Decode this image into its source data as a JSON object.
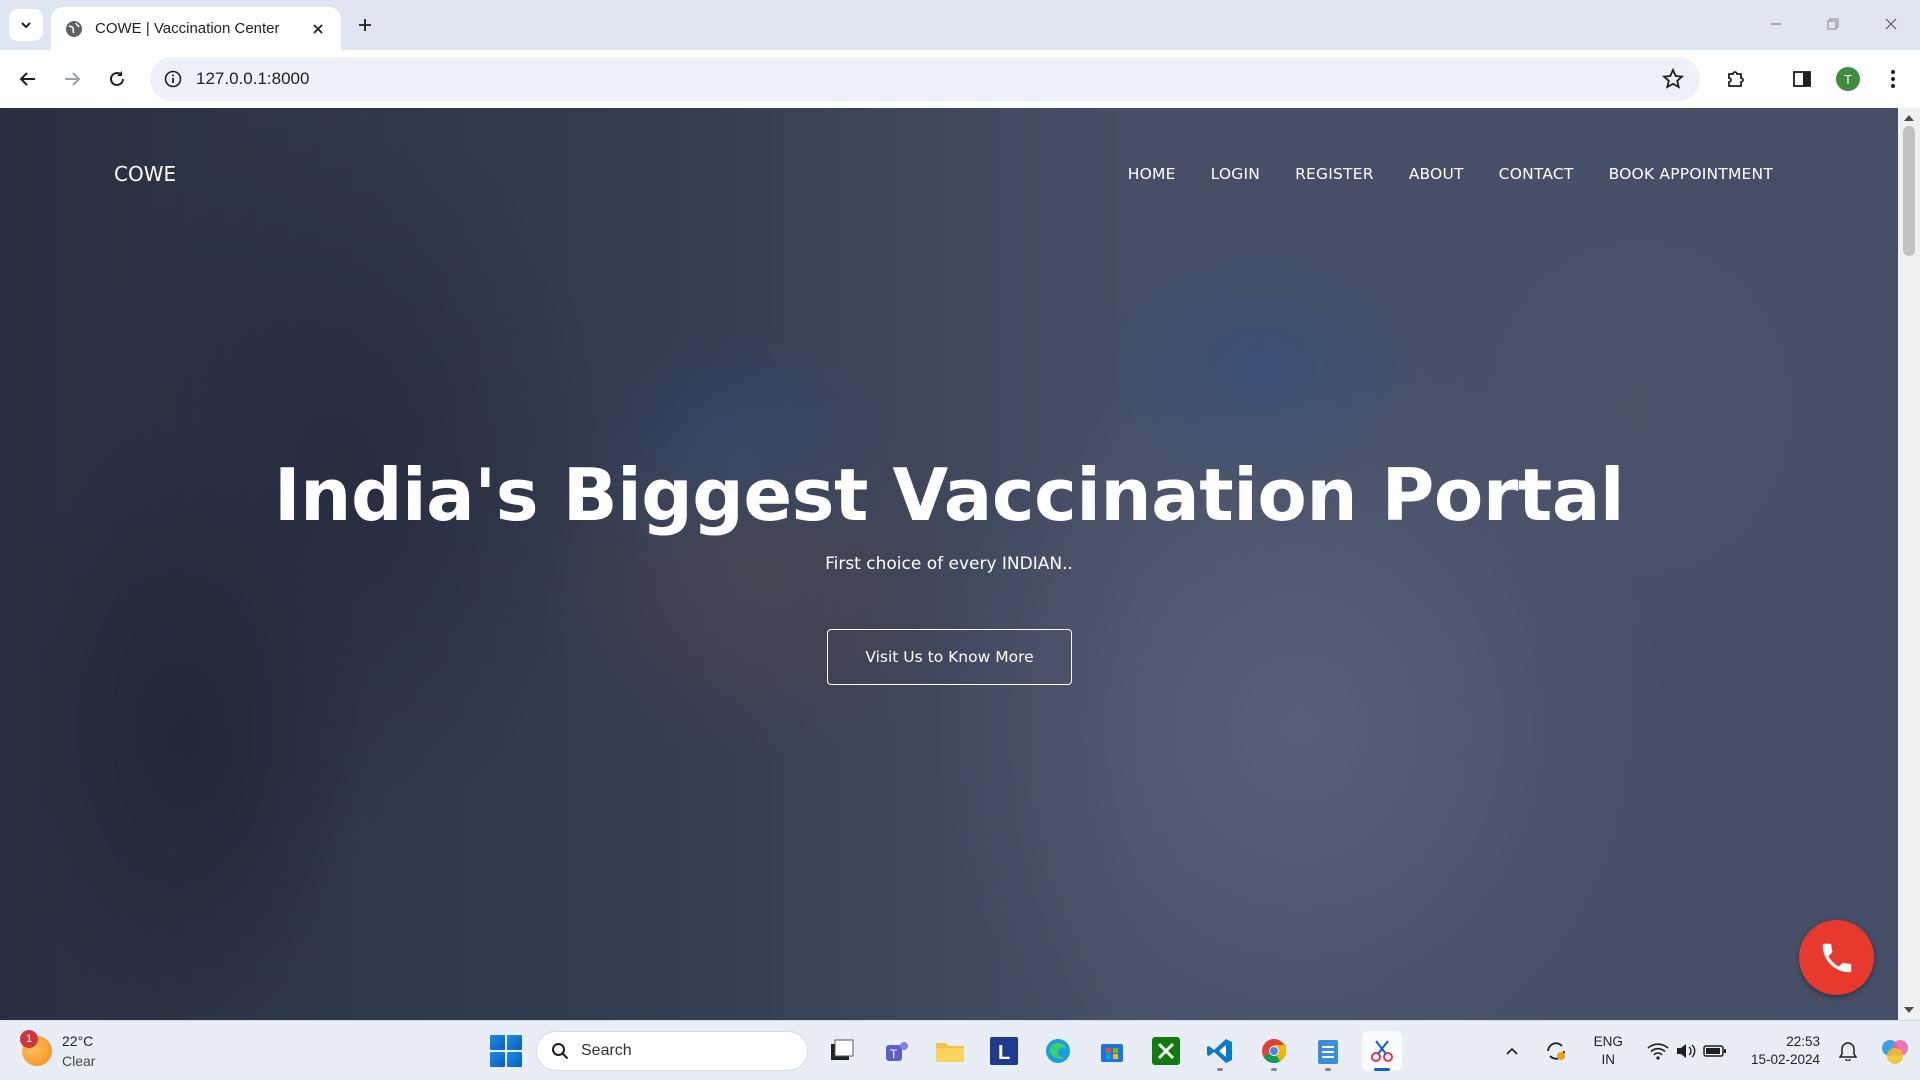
{
  "browser": {
    "tab_title": "COWE | Vaccination Center",
    "url": "127.0.0.1:8000",
    "profile_initial": "T"
  },
  "site": {
    "brand": "COWE",
    "nav": [
      "HOME",
      "LOGIN",
      "REGISTER",
      "ABOUT",
      "CONTACT",
      "BOOK APPOINTMENT"
    ],
    "hero_title": "India's Biggest Vaccination Portal",
    "hero_subtitle": "First choice of every INDIAN..",
    "hero_button": "Visit Us to Know More",
    "call_button_icon": "phone-icon"
  },
  "taskbar": {
    "weather_temp": "22°C",
    "weather_desc": "Clear",
    "weather_badge": "1",
    "search_label": "Search",
    "lang_line1": "ENG",
    "lang_line2": "IN",
    "time": "22:53",
    "date": "15-02-2024"
  },
  "colors": {
    "call_button": "#e8392f",
    "profile_avatar": "#3d8c40",
    "page_overlay": "#232d46"
  }
}
